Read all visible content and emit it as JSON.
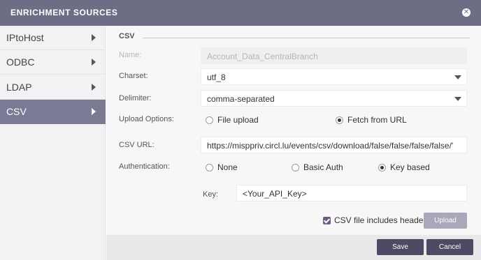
{
  "window": {
    "title": "ENRICHMENT SOURCES",
    "close_icon": "close-icon"
  },
  "sidebar": {
    "items": [
      {
        "label": "IPtoHost",
        "active": false
      },
      {
        "label": "ODBC",
        "active": false
      },
      {
        "label": "LDAP",
        "active": false
      },
      {
        "label": "CSV",
        "active": true
      }
    ]
  },
  "form": {
    "section_title": "CSV",
    "name": {
      "label": "Name:",
      "value": "Account_Data_CentralBranch"
    },
    "charset": {
      "label": "Charset:",
      "value": "utf_8"
    },
    "delimiter": {
      "label": "Delimiter:",
      "value": "comma-separated"
    },
    "upload_options": {
      "label": "Upload Options:",
      "options": [
        "File upload",
        "Fetch from URL"
      ],
      "selected": "Fetch from URL"
    },
    "csv_url": {
      "label": "CSV URL:",
      "value": "https://misppriv.circl.lu/events/csv/download/false/false/false/false/'"
    },
    "authentication": {
      "label": "Authentication:",
      "options": [
        "None",
        "Basic Auth",
        "Key based"
      ],
      "selected": "Key based"
    },
    "key": {
      "label": "Key:",
      "value": "<Your_API_Key>"
    },
    "header_checkbox": {
      "label": "CSV file includes header",
      "checked": true
    },
    "upload_label": "Upload"
  },
  "footer": {
    "save_label": "Save",
    "cancel_label": "Cancel"
  },
  "colors": {
    "titlebar": "#6e6d86",
    "sidebar_active": "#7b7a94",
    "primary_button": "#4c4b63",
    "upload_button": "#a9a8bb",
    "checkbox": "#6e5b86"
  }
}
